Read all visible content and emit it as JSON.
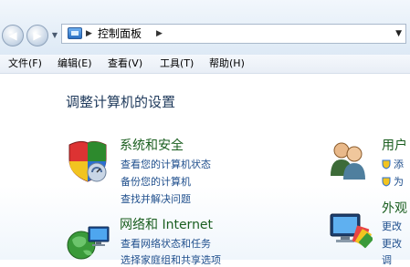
{
  "address_bar": {
    "breadcrumb": "控制面板",
    "icons": [
      "back-icon",
      "forward-icon",
      "history-dropdown-icon",
      "control-panel-icon",
      "breadcrumb-arrow-icon",
      "dropdown-icon"
    ]
  },
  "menu": {
    "items": [
      "文件(F)",
      "编辑(E)",
      "查看(V)",
      "工具(T)",
      "帮助(H)"
    ]
  },
  "main": {
    "title": "调整计算机的设置",
    "categories": [
      {
        "title": "系统和安全",
        "icon": "security-shield-icon",
        "links": [
          "查看您的计算机状态",
          "备份您的计算机",
          "查找并解决问题"
        ]
      },
      {
        "title": "网络和 Internet",
        "icon": "network-globe-icon",
        "links": [
          "查看网络状态和任务",
          "选择家庭组和共享选项"
        ]
      },
      {
        "title": "用户",
        "icon": "users-icon",
        "links": [
          "添",
          "为"
        ]
      },
      {
        "title": "外观",
        "icon": "appearance-monitor-icon",
        "links": [
          "更改",
          "更改",
          "调"
        ]
      }
    ]
  },
  "colors": {
    "category_title": "#1a5e1f",
    "link": "#1e4e8c",
    "page_title": "#1e395b"
  }
}
